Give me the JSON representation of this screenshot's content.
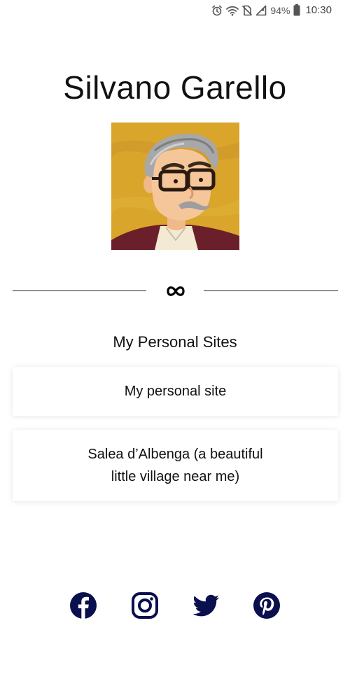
{
  "status_bar": {
    "battery_percent": "94%",
    "time": "10:30",
    "icons": [
      "alarm-icon",
      "wifi-icon",
      "no-sim-icon",
      "signal-icon",
      "battery-icon"
    ]
  },
  "profile": {
    "name": "Silvano Garello",
    "avatar_icon": "avatar-cartoon-man-with-glasses"
  },
  "divider": {
    "icon": "infinity-icon"
  },
  "links_section": {
    "heading": "My Personal Sites",
    "links": [
      {
        "label": "My personal site"
      },
      {
        "label": "Salea d’Albenga (a beautiful little village near me)"
      }
    ]
  },
  "social": {
    "items": [
      {
        "name": "facebook-icon"
      },
      {
        "name": "instagram-icon"
      },
      {
        "name": "twitter-icon"
      },
      {
        "name": "pinterest-icon"
      }
    ],
    "color": "#0a0f4e"
  },
  "colors": {
    "background": "#ffffff",
    "text": "#111111",
    "accent": "#0a0f4e",
    "avatar_bg": "#d9a52b"
  }
}
